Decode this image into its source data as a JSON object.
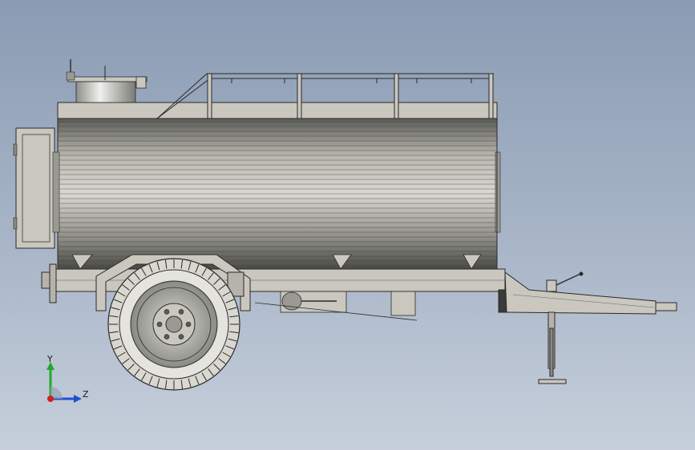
{
  "view": {
    "background_top": "#8a9bb3",
    "background_bottom": "#c6cfdb",
    "model": "tank-trailer",
    "model_color": "#c9c7be",
    "outline_color": "#2a2a2a"
  },
  "triad": {
    "y_label": "Y",
    "z_label": "Z",
    "y_color": "#1faa2a",
    "z_color": "#1f4fd0",
    "x_color": "#d01f1f"
  }
}
